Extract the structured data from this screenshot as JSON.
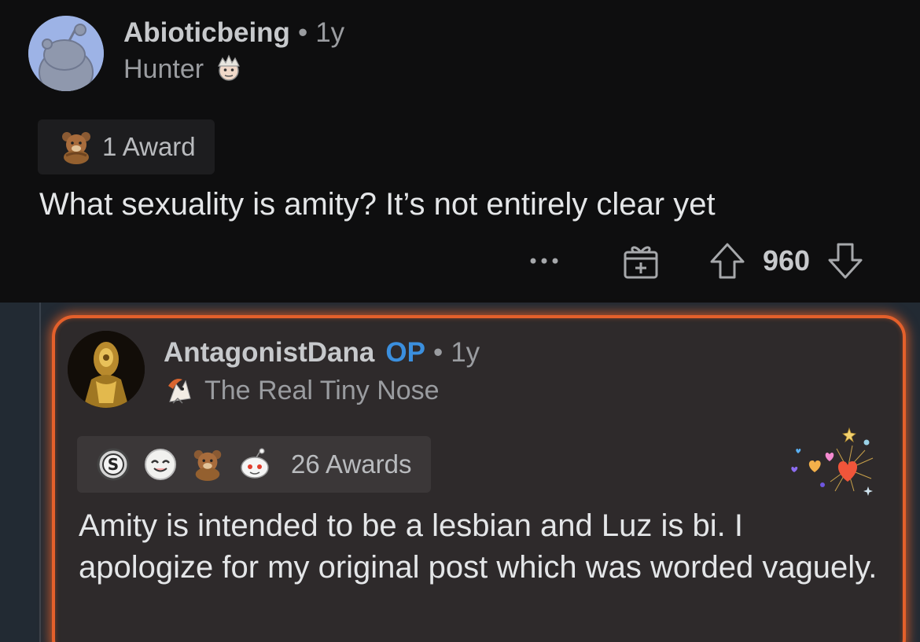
{
  "parent_comment": {
    "author": "Abioticbeing",
    "separator": "•",
    "age": "1y",
    "flair_text": "Hunter",
    "avatar_icon": "snoo-avatar-icon",
    "flair_icon": "hunter-face-icon",
    "award_icon": "bear-award-icon",
    "award_label": "1 Award",
    "body": "What sexuality is amity? It’s not entirely clear yet",
    "actions": {
      "more_icon": "more-dots-icon",
      "gift_icon": "gift-award-icon",
      "upvote_icon": "upvote-arrow-icon",
      "score": "960",
      "downvote_icon": "downvote-arrow-icon"
    }
  },
  "reply_comment": {
    "author": "AntagonistDana",
    "op_label": "OP",
    "separator": "•",
    "age": "1y",
    "flair_text": "The Real Tiny Nose",
    "flair_icon": "owl-character-icon",
    "avatar_icon": "golden-figure-avatar",
    "award_icons": [
      "silver-award-icon",
      "wholesome-award-icon",
      "bear-award-icon",
      "snoo-award-icon"
    ],
    "awards_label": "26 Awards",
    "decoration_icon": "heart-burst-icon",
    "body": "Amity is intended to be a lesbian and Luz is bi. I apologize for my original post which was worded vaguely."
  },
  "colors": {
    "background": "#0e0e0f",
    "reply_region": "#222a33",
    "card": "#2e2a2b",
    "glow_border": "#e4602b",
    "op_blue": "#3b8fde"
  }
}
